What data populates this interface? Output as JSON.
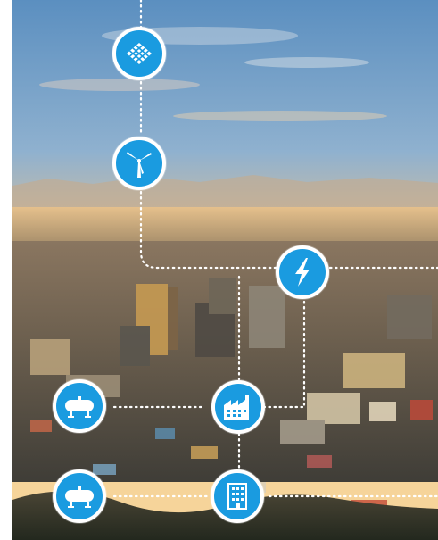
{
  "image": {
    "subject": "city-at-sunset",
    "colors": {
      "accent": "#1a9be0",
      "connector": "#ffffff",
      "sky_top": "#5f93c2",
      "sky_bottom": "#f4c98a"
    }
  },
  "icons": [
    {
      "name": "solar-panel-icon"
    },
    {
      "name": "wind-turbine-icon"
    },
    {
      "name": "lightning-icon"
    },
    {
      "name": "gas-tank-icon"
    },
    {
      "name": "factory-icon"
    },
    {
      "name": "gas-tank-icon"
    },
    {
      "name": "building-icon"
    }
  ]
}
